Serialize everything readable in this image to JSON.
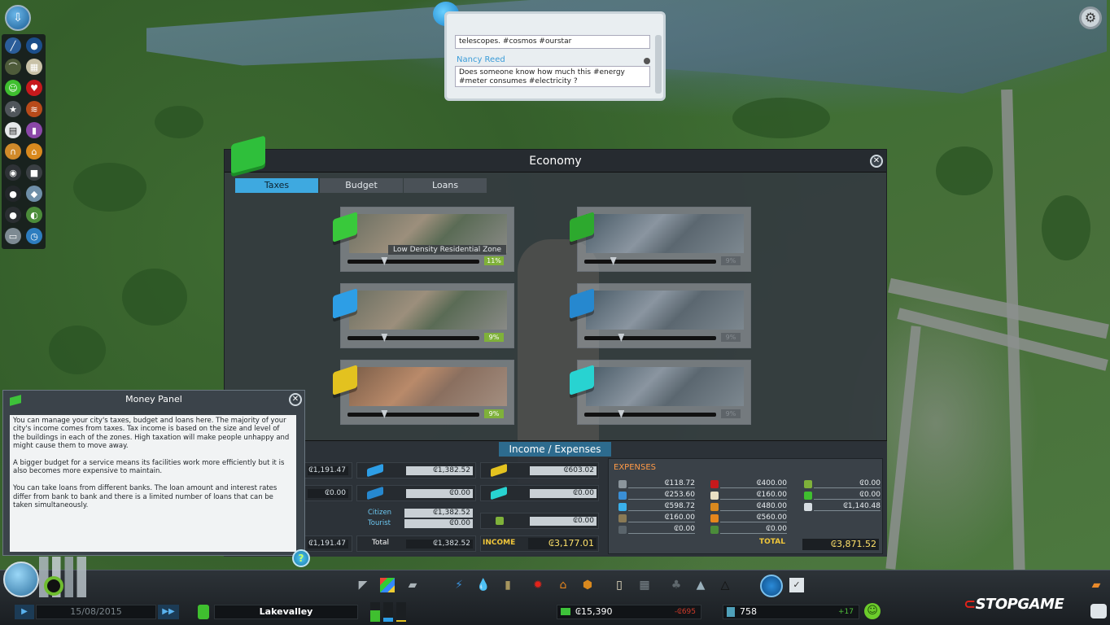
{
  "chirper": {
    "msg1": "telescopes. #cosmos #ourstar",
    "author2": "Nancy Reed",
    "msg2": "Does someone know how much this #energy #meter consumes #electricity ?"
  },
  "economy": {
    "title": "Economy",
    "tabs": [
      "Taxes",
      "Budget",
      "Loans"
    ],
    "tooltip": "Low Density Residential Zone",
    "zones": [
      {
        "pct": "11%",
        "level": 0.28,
        "active": true,
        "color": "#39c93b"
      },
      {
        "pct": "9%",
        "level": 0.22,
        "active": false,
        "color": "#2da92e"
      },
      {
        "pct": "9%",
        "level": 0.28,
        "active": true,
        "color": "#2d9ee6"
      },
      {
        "pct": "9%",
        "level": 0.28,
        "active": false,
        "color": "#2688cf"
      },
      {
        "pct": "9%",
        "level": 0.28,
        "active": true,
        "color": "#e3c21f"
      },
      {
        "pct": "9%",
        "level": 0.28,
        "active": false,
        "color": "#28d3d1"
      }
    ]
  },
  "income": {
    "title": "Income / Expenses",
    "col1": [
      "₢1,191.47",
      "₢0.00",
      "₢1,191.47"
    ],
    "commercial": [
      "₢1,382.52",
      "₢0.00"
    ],
    "citizen_label": "Citizen",
    "tourist_label": "Tourist",
    "citizen_val": "₢1,382.52",
    "tourist_val": "₢0.00",
    "total_label": "Total",
    "total_val": "₢1,382.52",
    "industry": [
      "₢603.02",
      "₢0.00",
      "₢0.00"
    ],
    "income_label": "INCOME",
    "income_val": "₢3,177.01"
  },
  "expenses": {
    "title": "EXPENSES",
    "colA": [
      "₢118.72",
      "₢253.60",
      "₢598.72",
      "₢160.00",
      "₢0.00"
    ],
    "colB": [
      "₢400.00",
      "₢160.00",
      "₢480.00",
      "₢560.00",
      "₢0.00"
    ],
    "colC": [
      "₢0.00",
      "₢0.00",
      "₢1,140.48"
    ],
    "total_label": "TOTAL",
    "total_val": "₢3,871.52"
  },
  "money_panel": {
    "title": "Money Panel",
    "text": "You can manage your city's taxes, budget and loans here. The majority of your city's income comes from taxes. Tax income is based on the size and level of the buildings in each of the zones. High taxation will make people unhappy and might cause them to move away.\n\nA bigger budget for a service means its facilities work more efficiently but it is also becomes more expensive to maintain.\n\nYou can take loans from different banks. The loan amount and interest rates differ from bank to bank and there is a limited number of loans that can be taken simultaneously."
  },
  "status": {
    "date": "15/08/2015",
    "city": "Lakevalley",
    "money": "₢15,390",
    "money_delta": "-₢695",
    "population": "758",
    "pop_delta": "+17",
    "watermark": "STOPGAME"
  }
}
